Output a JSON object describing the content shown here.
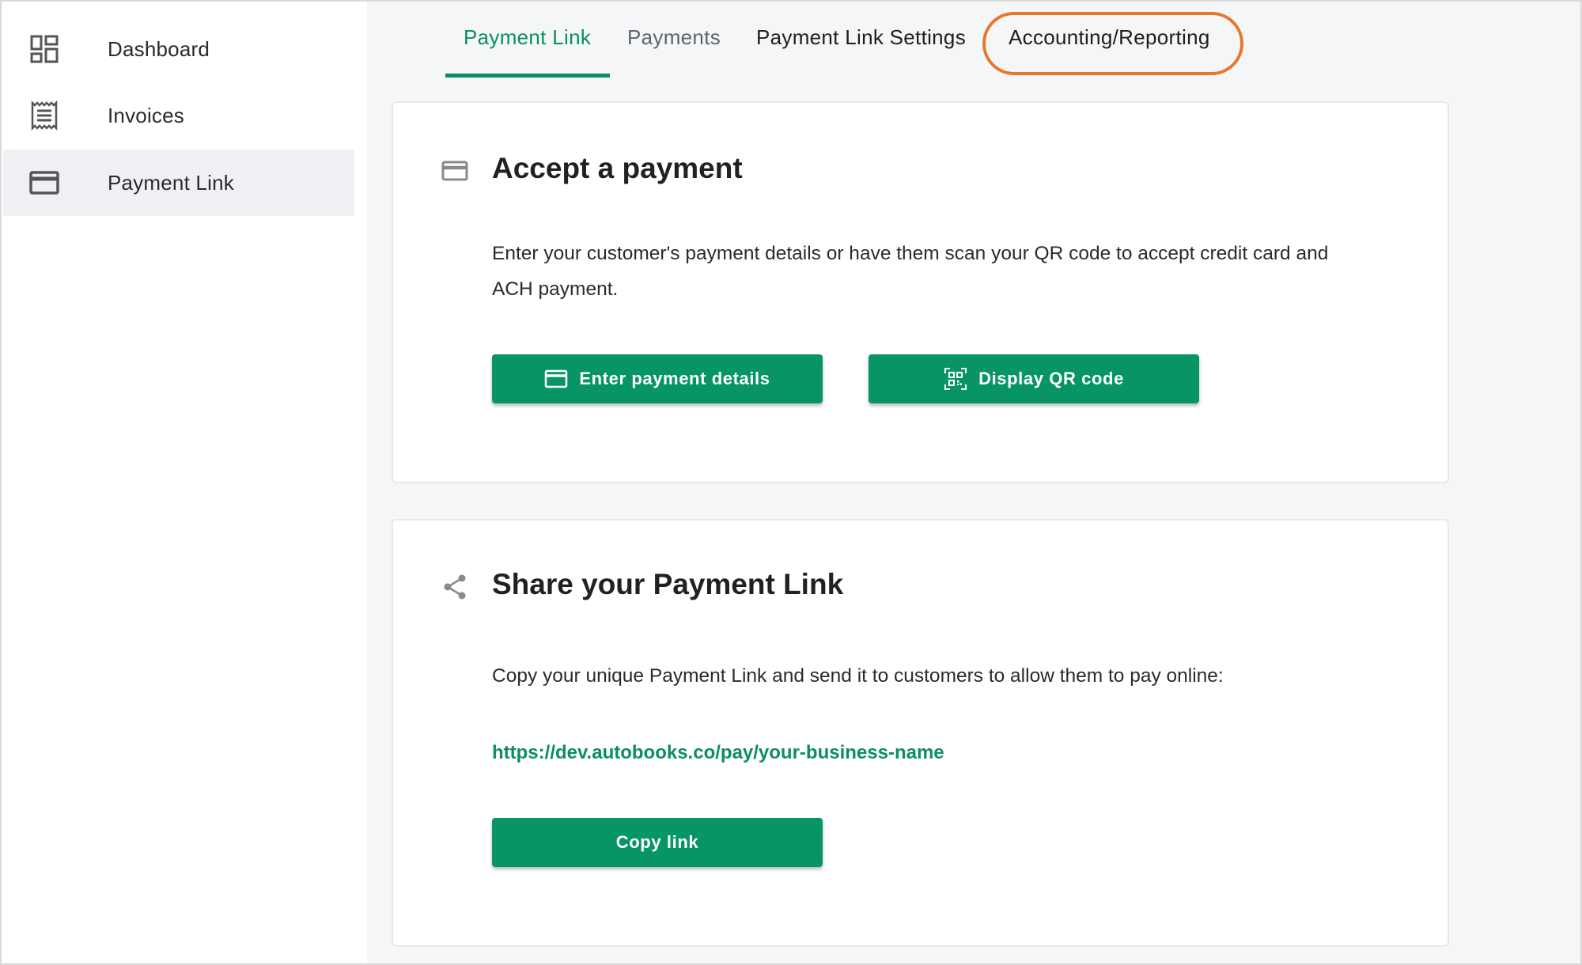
{
  "sidebar": {
    "items": [
      {
        "label": "Dashboard",
        "icon": "dashboard-icon"
      },
      {
        "label": "Invoices",
        "icon": "receipt-icon"
      },
      {
        "label": "Payment Link",
        "icon": "credit-card-icon",
        "active": true
      }
    ]
  },
  "tabs": [
    {
      "label": "Payment Link",
      "active": true
    },
    {
      "label": "Payments"
    },
    {
      "label": "Payment Link Settings"
    },
    {
      "label": "Accounting/Reporting",
      "highlighted": true
    }
  ],
  "accept_card": {
    "icon": "credit-card-icon",
    "title": "Accept a payment",
    "description": "Enter your customer's payment details or have them scan your QR code to accept credit card and ACH payment.",
    "buttons": [
      {
        "label": "Enter payment details",
        "icon": "credit-card-icon"
      },
      {
        "label": "Display QR code",
        "icon": "qr-code-icon"
      }
    ]
  },
  "share_card": {
    "icon": "share-icon",
    "title": "Share your Payment Link",
    "description": "Copy your unique Payment Link and send it to customers to allow them to pay online:",
    "link": "https://dev.autobooks.co/pay/your-business-name",
    "button": {
      "label": "Copy link"
    }
  },
  "colors": {
    "accent": "#0b8f5e",
    "button": "#079566",
    "highlight_ring": "#e8772e",
    "sidebar_active": "#eef0f3"
  }
}
